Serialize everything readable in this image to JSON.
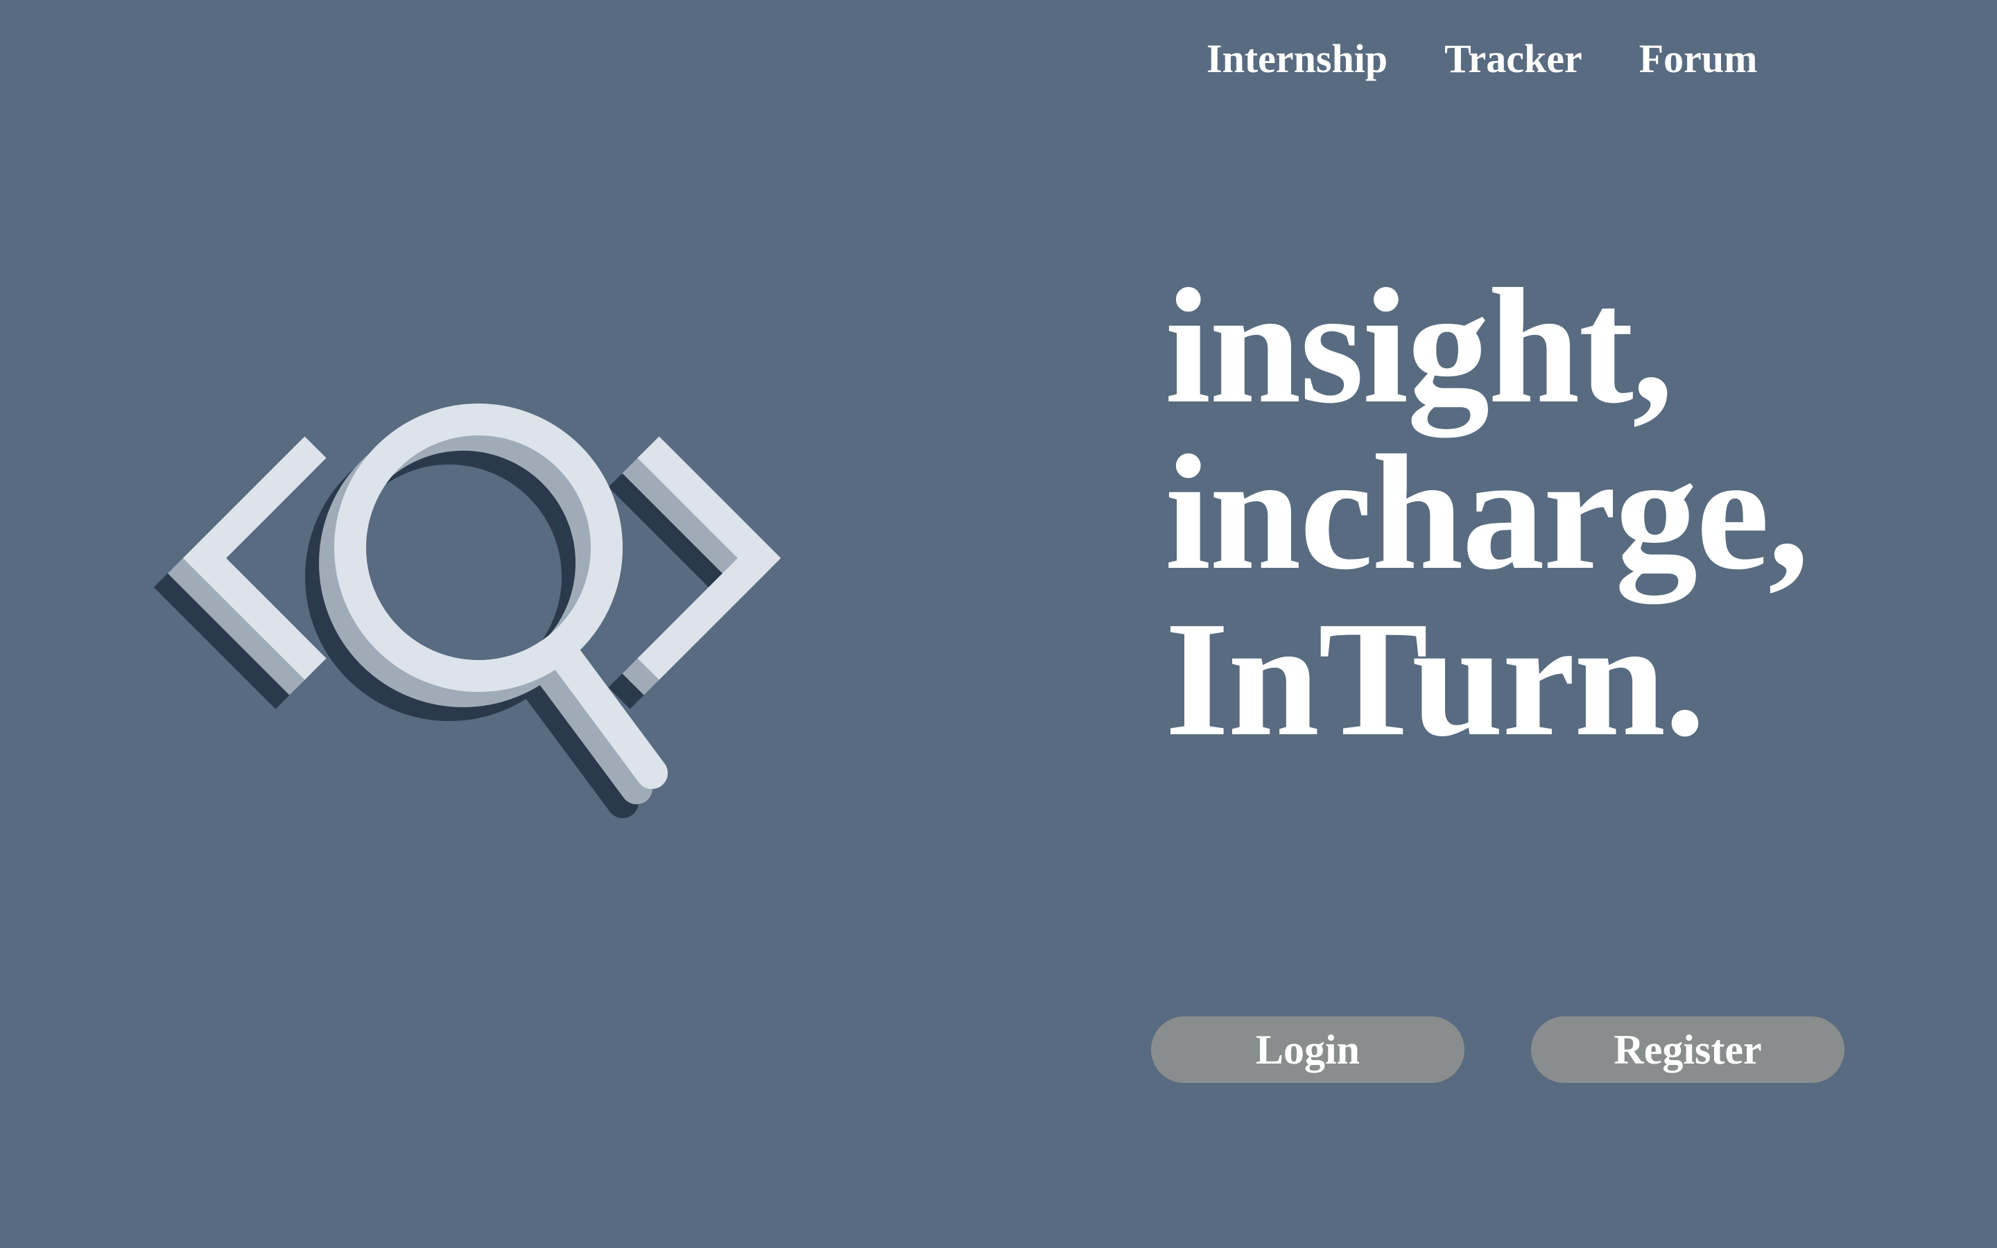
{
  "nav": {
    "items": [
      {
        "label": "Internship"
      },
      {
        "label": "Tracker"
      },
      {
        "label": "Forum"
      }
    ]
  },
  "logo": {
    "icon": "code-brackets-magnifier-logo",
    "colors": {
      "light": "#dde3ea",
      "mid": "#9facb8",
      "dark": "#2b394c"
    }
  },
  "hero": {
    "lines": [
      "insight,",
      "incharge,",
      "InTurn."
    ]
  },
  "actions": {
    "login_label": "Login",
    "register_label": "Register"
  },
  "colors": {
    "background": "#586b80",
    "button": "#8a8d8e",
    "text": "#ffffff"
  }
}
